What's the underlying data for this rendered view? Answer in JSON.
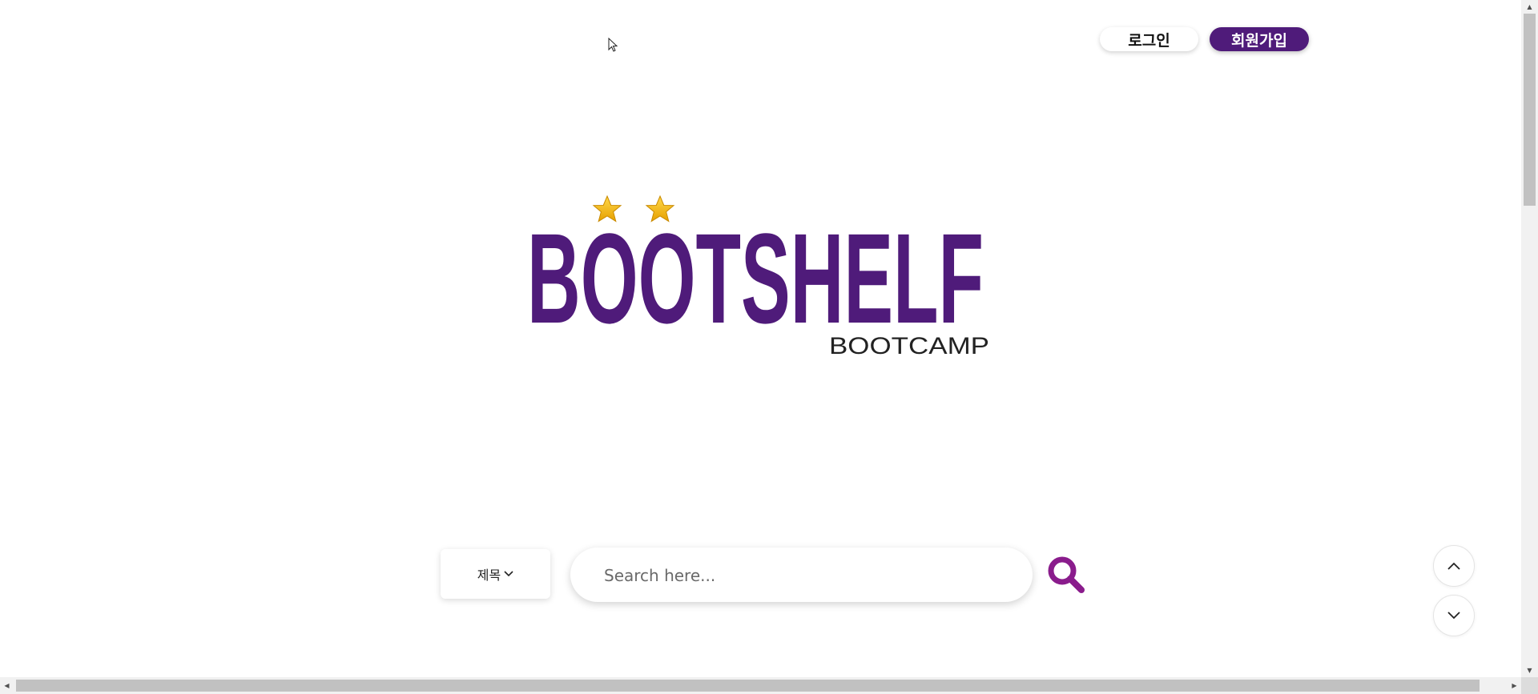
{
  "header": {
    "login_label": "로그인",
    "signup_label": "회원가입"
  },
  "logo": {
    "title": "BOOTSHELF",
    "subtitle": "BOOTCAMP",
    "brand_color": "#4f1b7a",
    "star_color": "#f5b800"
  },
  "search": {
    "type_selected": "제목",
    "placeholder": "Search here..."
  },
  "icons": {
    "search": "search-icon",
    "scroll_up": "chevron-up-icon",
    "scroll_down": "chevron-down-icon"
  }
}
